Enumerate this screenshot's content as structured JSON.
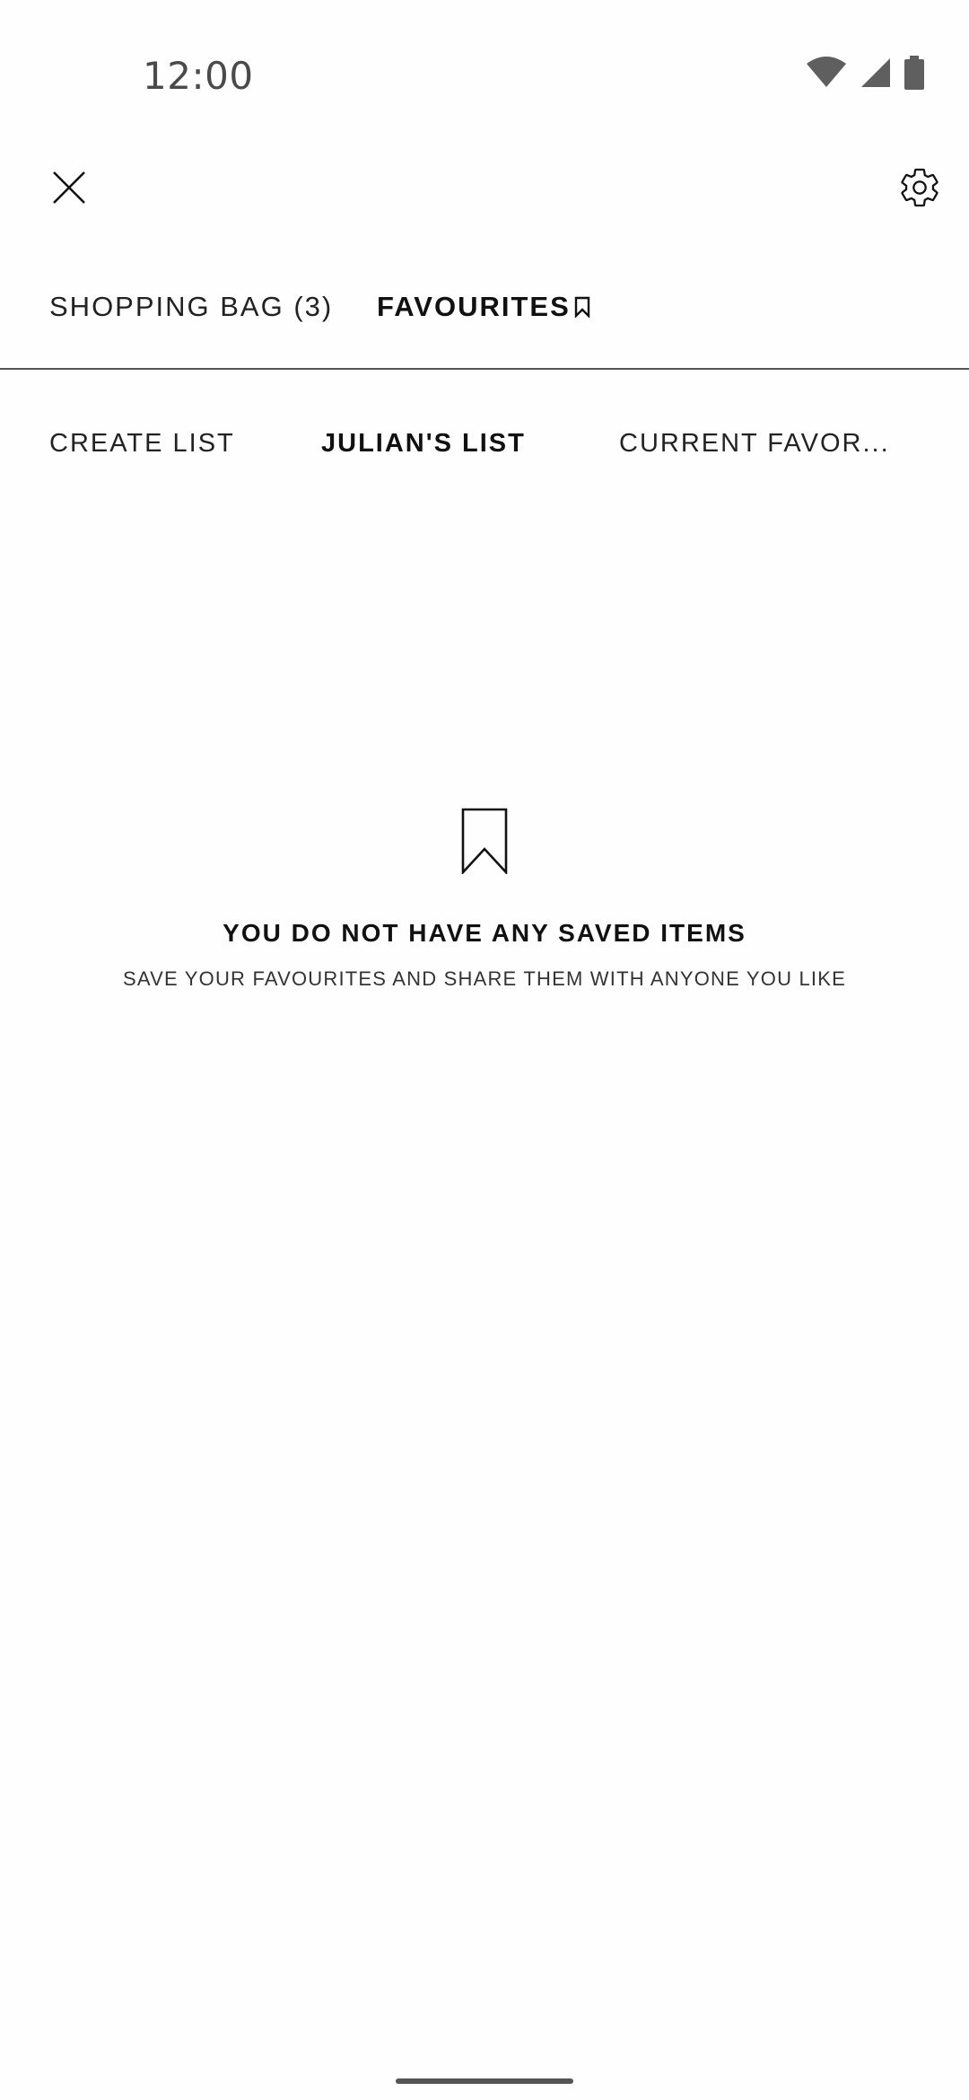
{
  "status_bar": {
    "time": "12:00",
    "icons": [
      "wifi-icon",
      "cellular-signal-icon",
      "battery-icon"
    ]
  },
  "toolbar": {
    "close_icon": "close-icon",
    "settings_icon": "gear-icon"
  },
  "main_tabs": [
    {
      "label": "SHOPPING BAG (3)",
      "active": false
    },
    {
      "label": "FAVOURITES",
      "active": true,
      "icon": "bookmark-icon"
    }
  ],
  "sub_tabs": [
    {
      "label": "CREATE LIST",
      "active": false
    },
    {
      "label": "JULIAN'S LIST",
      "active": true
    },
    {
      "label": "CURRENT FAVOR...",
      "active": false
    }
  ],
  "empty_state": {
    "icon": "bookmark-icon",
    "title": "YOU DO NOT HAVE ANY SAVED ITEMS",
    "subtitle": "SAVE YOUR FAVOURITES AND SHARE THEM WITH ANYONE YOU LIKE"
  },
  "colors": {
    "background": "#fefefe",
    "text": "#111111",
    "divider": "#555555",
    "status_icons": "#5f5f5f"
  }
}
